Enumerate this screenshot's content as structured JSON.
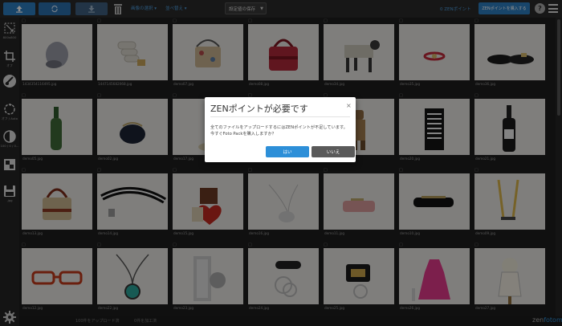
{
  "toolbar": {
    "upload_icon": "upload-icon",
    "sync_icon": "sync-icon",
    "download_icon": "download-icon",
    "trash_icon": "trash-icon",
    "select_all": "画像の選択 ▾",
    "sort": "並べ替え ▾",
    "save_settings": "設定値の保存",
    "points": "0 ZENポイント",
    "buy_points": "ZENポイントを購入する",
    "help": "?"
  },
  "sidebar": {
    "tools": [
      {
        "icon": "resize-icon",
        "label": "800x800"
      },
      {
        "icon": "crop-icon",
        "label": "オフ"
      },
      {
        "icon": "background-icon",
        "label": ""
      },
      {
        "icon": "rotate-icon",
        "label": "オフ / Auto"
      },
      {
        "icon": "contrast-icon",
        "label": "100 / 0 / 0..."
      },
      {
        "icon": "shadow-icon",
        "label": ""
      },
      {
        "icon": "save-format-icon",
        "label": ".jpg"
      }
    ],
    "settings_icon": "gear-icon"
  },
  "grid": {
    "items": [
      {
        "file": "1434354116495.jpg",
        "object": "beanie"
      },
      {
        "file": "1447145682068.jpg",
        "object": "bulb"
      },
      {
        "file": "demo07.jpg",
        "object": "pouch"
      },
      {
        "file": "demo08.jpg",
        "object": "handbag-red"
      },
      {
        "file": "demo34.jpg",
        "object": "dog"
      },
      {
        "file": "demo35.jpg",
        "object": "bracelet"
      },
      {
        "file": "demo36.jpg",
        "object": "shoe"
      },
      {
        "file": "demo05.jpg",
        "object": "bottle"
      },
      {
        "file": "demo02.jpg",
        "object": "coin-purse"
      },
      {
        "file": "demo17.jpg",
        "object": "roll"
      },
      {
        "file": "demo18.jpg",
        "object": "hidden"
      },
      {
        "file": "demo19.jpg",
        "object": "figure"
      },
      {
        "file": "demo20.jpg",
        "object": "apron"
      },
      {
        "file": "demo21.jpg",
        "object": "wine"
      },
      {
        "file": "demo13.jpg",
        "object": "handbag-check"
      },
      {
        "file": "demo14.jpg",
        "object": "strap"
      },
      {
        "file": "demo15.jpg",
        "object": "heart-box"
      },
      {
        "file": "demo16.jpg",
        "object": "tag-necklace"
      },
      {
        "file": "demo11.jpg",
        "object": "glasses-case"
      },
      {
        "file": "demo10.jpg",
        "object": "pen-case"
      },
      {
        "file": "demo09.jpg",
        "object": "lanyard"
      },
      {
        "file": "demo12.jpg",
        "object": "red-glasses"
      },
      {
        "file": "demo22.jpg",
        "object": "pendant"
      },
      {
        "file": "demo23.jpg",
        "object": "watch"
      },
      {
        "file": "demo24.jpg",
        "object": "keyring"
      },
      {
        "file": "demo25.jpg",
        "object": "keyring-plate"
      },
      {
        "file": "demo26.jpg",
        "object": "dress"
      },
      {
        "file": "demo27.jpg",
        "object": "mannequin"
      }
    ]
  },
  "status": {
    "uploaded": "100件をアップロード済",
    "processed": "0件を加工済"
  },
  "brand": {
    "prefix": "zen",
    "suffix": "fotomatic"
  },
  "dialog": {
    "title": "ZENポイントが必要です",
    "close": "×",
    "message": "全てのファイルをアップロードするにはZENポイントが不足しています。 今すぐFoto Packを購入しますか？",
    "yes": "はい",
    "no": "いいえ"
  }
}
